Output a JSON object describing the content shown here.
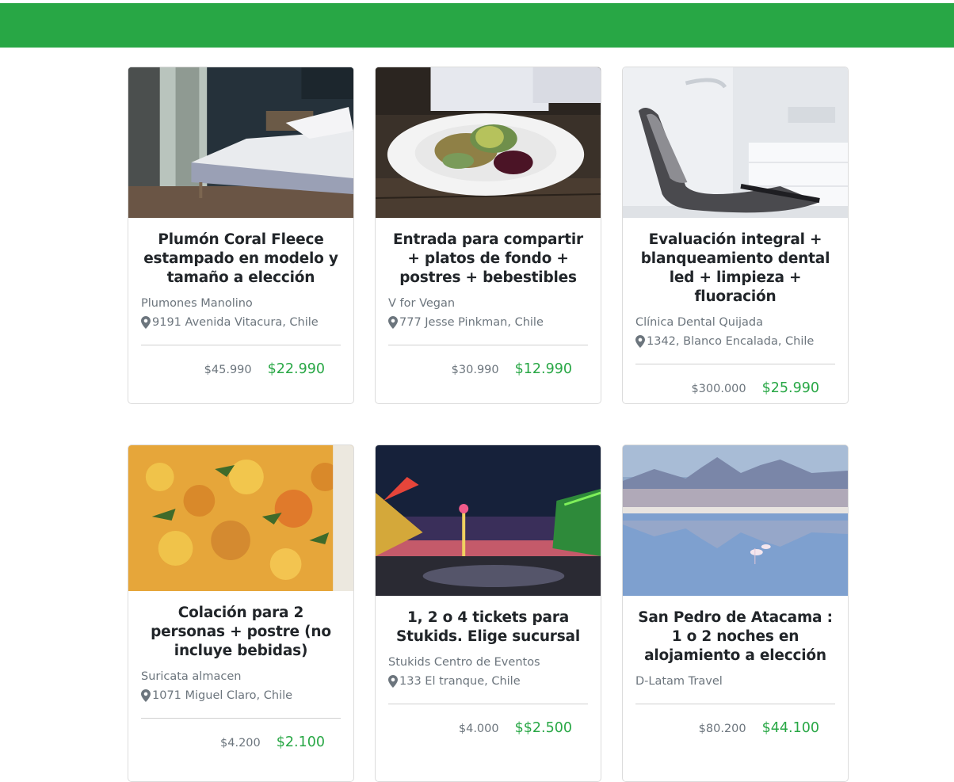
{
  "colors": {
    "header": "#28a745",
    "price_new": "#28a745",
    "muted_text": "#6c757d"
  },
  "deals": [
    {
      "title": "Plumón Coral Fleece estampado en modelo y tamaño a elección",
      "merchant": "Plumones Manolino",
      "address": "9191 Avenida Vitacura, Chile",
      "old_price": "$45.990",
      "new_price": "$22.990",
      "image": "bedroom-photo"
    },
    {
      "title": "Entrada para compartir + platos de fondo + postres + bebestibles",
      "merchant": "V for Vegan",
      "address": "777 Jesse Pinkman, Chile",
      "old_price": "$30.990",
      "new_price": "$12.990",
      "image": "salad-plate-photo"
    },
    {
      "title": "Evaluación integral + blanqueamiento dental led + limpieza + fluoración",
      "merchant": "Clínica Dental Quijada",
      "address": "1342, Blanco Encalada, Chile",
      "old_price": "$300.000",
      "new_price": "$25.990",
      "image": "dental-chair-photo"
    },
    {
      "title": "Colación para 2 personas + postre (no incluye bebidas)",
      "merchant": "Suricata almacen",
      "address": "1071 Miguel Claro, Chile",
      "old_price": "$4.200",
      "new_price": "$2.100",
      "image": "vegetable-dish-photo"
    },
    {
      "title": "1, 2 o 4 tickets para Stukids. Elige sucursal",
      "merchant": "Stukids Centro de Eventos",
      "address": "133 El tranque, Chile",
      "old_price": "$4.000",
      "new_price": "$$2.500",
      "image": "carnival-night-photo"
    },
    {
      "title": "San Pedro de Atacama : 1 o 2 noches en alojamiento a elección",
      "merchant": "D-Latam Travel",
      "address": "",
      "old_price": "$80.200",
      "new_price": "$44.100",
      "image": "atacama-lagoon-photo"
    }
  ]
}
